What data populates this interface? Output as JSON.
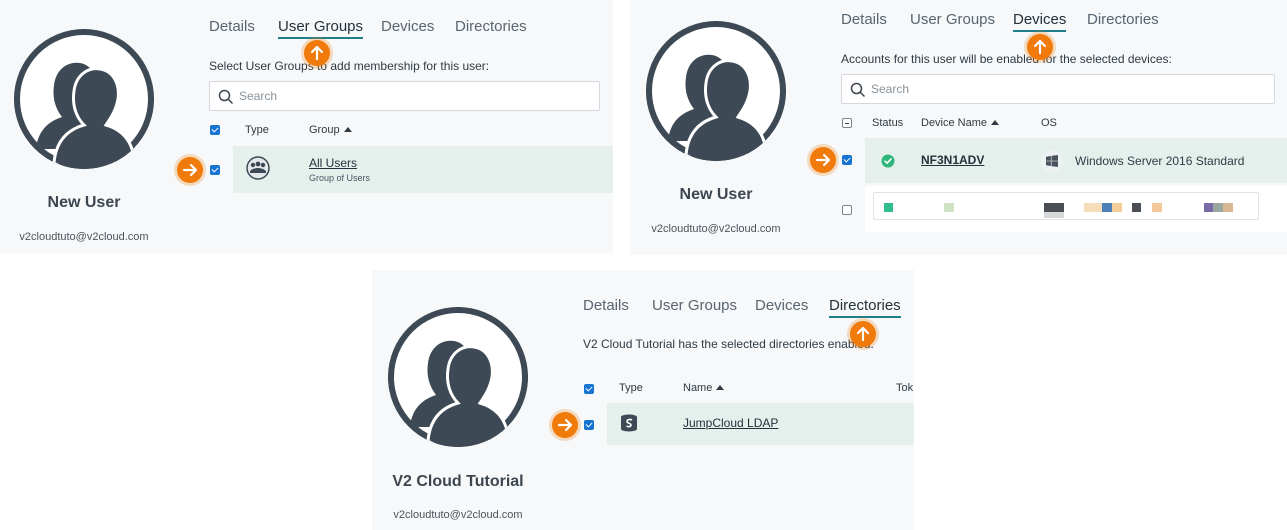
{
  "panel_user_groups": {
    "user": {
      "name": "New User",
      "email": "v2cloudtuto@v2cloud.com"
    },
    "tabs": [
      {
        "label": "Details",
        "active": false
      },
      {
        "label": "User Groups",
        "active": true
      },
      {
        "label": "Devices",
        "active": false
      },
      {
        "label": "Directories",
        "active": false
      }
    ],
    "instruction": "Select User Groups to add membership for this user:",
    "search_placeholder": "Search",
    "columns": {
      "type": "Type",
      "group": "Group"
    },
    "rows": [
      {
        "name": "All Users",
        "description": "Group of Users",
        "checked": true
      }
    ]
  },
  "panel_devices": {
    "user": {
      "name": "New User",
      "email": "v2cloudtuto@v2cloud.com"
    },
    "tabs": [
      {
        "label": "Details",
        "active": false
      },
      {
        "label": "User Groups",
        "active": false
      },
      {
        "label": "Devices",
        "active": true
      },
      {
        "label": "Directories",
        "active": false
      }
    ],
    "instruction": "Accounts for this user will be enabled for the selected devices:",
    "search_placeholder": "Search",
    "columns": {
      "status": "Status",
      "device_name": "Device Name",
      "os": "OS"
    },
    "rows": [
      {
        "device_name": "NF3N1ADV",
        "os": "Windows Server 2016 Standard",
        "status": "online",
        "checked": true
      },
      {
        "device_name": "",
        "os": "",
        "status": "redacted",
        "checked": false
      }
    ]
  },
  "panel_directories": {
    "user": {
      "name": "V2 Cloud Tutorial",
      "email": "v2cloudtuto@v2cloud.com"
    },
    "tabs": [
      {
        "label": "Details",
        "active": false
      },
      {
        "label": "User Groups",
        "active": false
      },
      {
        "label": "Devices",
        "active": false
      },
      {
        "label": "Directories",
        "active": true
      }
    ],
    "instruction": "V2 Cloud Tutorial has the selected directories enabled:",
    "columns": {
      "type": "Type",
      "name": "Name",
      "token": "Tok"
    },
    "rows": [
      {
        "name": "JumpCloud LDAP",
        "checked": true
      }
    ]
  },
  "colors": {
    "accent_orange": "#f07a0a",
    "active_tab_underline": "#1e7f8a",
    "checkbox_blue": "#1673d1",
    "row_highlight": "#e5f0ed",
    "status_green": "#2fb67a",
    "avatar_dark": "#3d4a55"
  },
  "icons": [
    "search-icon",
    "group-icon",
    "windows-icon",
    "check-circle-icon",
    "ldap-icon",
    "arrow-up-icon",
    "arrow-right-icon",
    "caret-up-icon"
  ]
}
